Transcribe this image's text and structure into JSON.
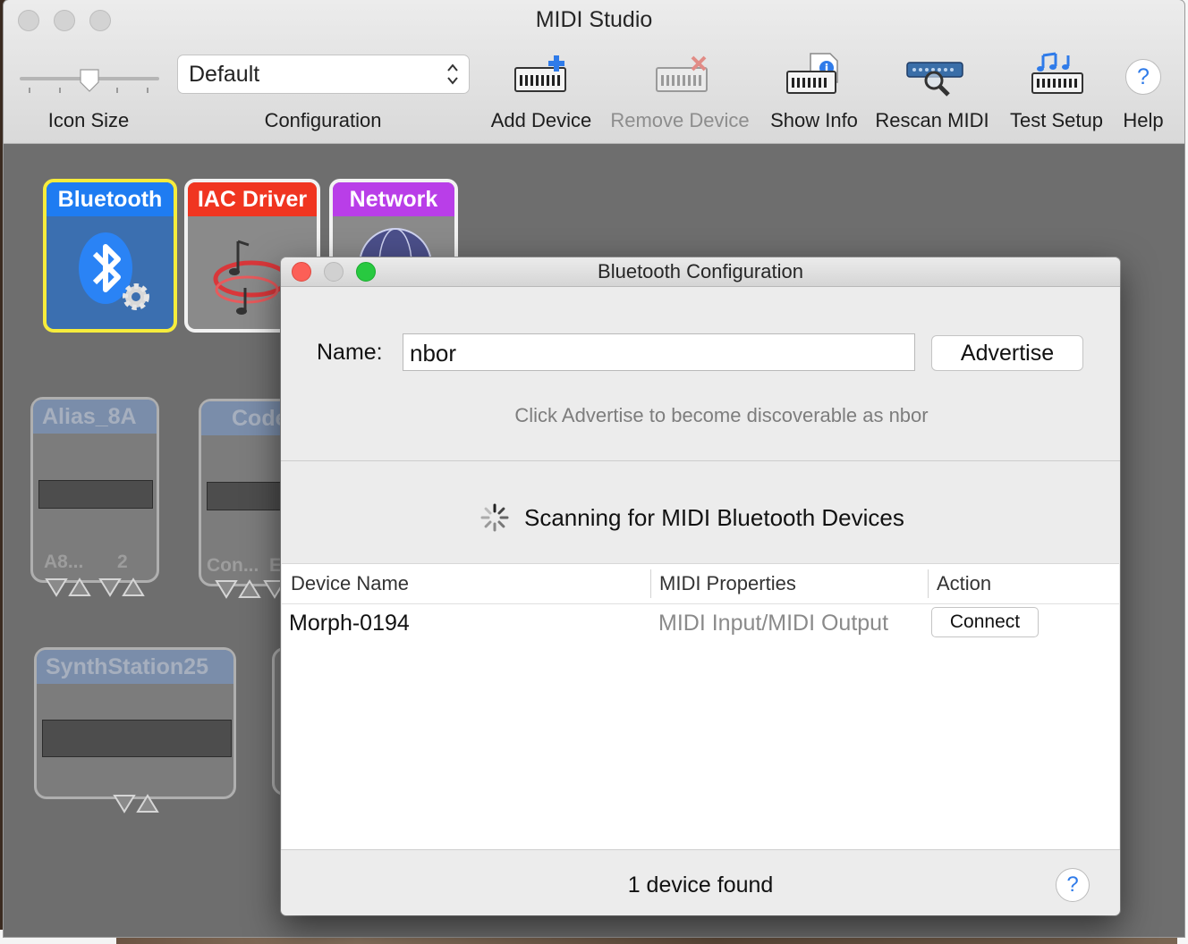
{
  "window": {
    "title": "MIDI Studio"
  },
  "toolbar": {
    "icon_size_label": "Icon Size",
    "configuration_label": "Configuration",
    "configuration_value": "Default",
    "add_device_label": "Add Device",
    "remove_device_label": "Remove Device",
    "show_info_label": "Show Info",
    "rescan_midi_label": "Rescan MIDI",
    "test_setup_label": "Test Setup",
    "help_label": "Help",
    "help_glyph": "?"
  },
  "drivers": {
    "bluetooth": "Bluetooth",
    "iac": "IAC Driver",
    "network": "Network"
  },
  "devices": {
    "alias": {
      "name": "Alias_8A",
      "port_a": "A8...",
      "port_b": "2"
    },
    "code": {
      "name": "Code",
      "port_a": "Con...",
      "port_b": "E"
    },
    "synth": {
      "name": "SynthStation25"
    }
  },
  "dialog": {
    "title": "Bluetooth Configuration",
    "name_label": "Name:",
    "name_value": "nbor",
    "advertise_button": "Advertise",
    "hint": "Click Advertise to become discoverable as nbor",
    "scanning": "Scanning for MIDI Bluetooth Devices",
    "columns": [
      "Device Name",
      "MIDI Properties",
      "Action"
    ],
    "rows": [
      {
        "name": "Morph-0194",
        "properties": "MIDI Input/MIDI Output",
        "action": "Connect"
      }
    ],
    "footer": "1 device found",
    "help_glyph": "?"
  },
  "colors": {
    "bluetooth_header": "#1e7cf2",
    "iac_header": "#f03520",
    "network_header": "#b93ee8",
    "selection_border": "#f6ec3c",
    "close_light": "#fc5f57",
    "minimize_light": "#d1d1d1",
    "zoom_light": "#28c940"
  }
}
